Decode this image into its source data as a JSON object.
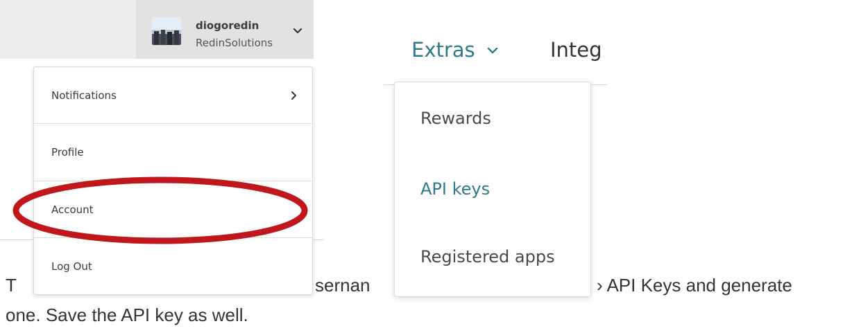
{
  "user_menu": {
    "username": "diogoredin",
    "company": "RedinSolutions",
    "items": [
      {
        "label": "Notifications",
        "has_submenu": true
      },
      {
        "label": "Profile"
      },
      {
        "label": "Account",
        "highlighted": true
      },
      {
        "label": "Log Out"
      }
    ]
  },
  "nav": {
    "extras_label": "Extras",
    "integrations_label_visible": "Integ"
  },
  "extras_menu": {
    "items": [
      {
        "label": "Rewards"
      },
      {
        "label": "API keys",
        "active": true
      },
      {
        "label": "Registered apps"
      }
    ]
  },
  "body_text": {
    "line1_start": "T",
    "line1_middle": "sernan",
    "line1_end": "› API Keys and generate",
    "line2": "one. Save the API key as well."
  },
  "colors": {
    "accent_teal": "#2c7b88",
    "highlight_red": "#c0161c",
    "header_bg": "#ececec"
  }
}
